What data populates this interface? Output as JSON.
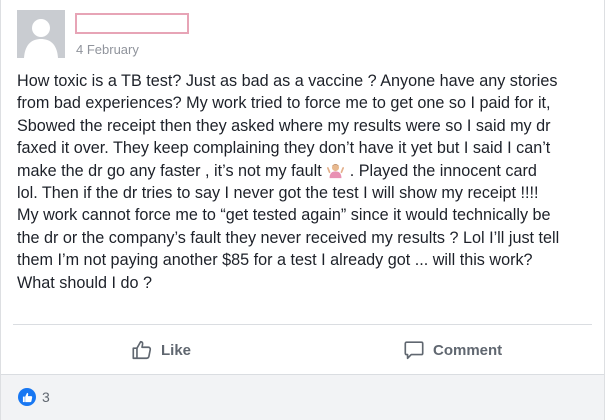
{
  "post": {
    "date": "4 February",
    "lines": [
      "How toxic is a TB test? Just as bad as a vaccine ? Anyone have any stories",
      "from bad experiences? My work tried to force me to get one so I paid for it,",
      "Sbowed the receipt then they asked where my results were so I said my dr",
      "faxed it over. They keep complaining they don’t have it yet but I said I can’t",
      "make the dr go any faster , it’s not my fault",
      ". Played the innocent card",
      "lol. Then if the dr tries to say I never got the test I will show my receipt !!!!",
      "My work cannot force me to “get tested again” since it would technically be",
      "the dr or the company’s fault they never received my results ? Lol I’ll just tell",
      "them I’m not paying another $85 for a test I already got ... will this work?",
      "What should I do ?"
    ],
    "emoji": "person-shrugging-emoji"
  },
  "actions": {
    "like_label": "Like",
    "comment_label": "Comment"
  },
  "reactions": {
    "count": "3",
    "icon": "thumbs-up-icon"
  },
  "colors": {
    "accent": "#1877f2",
    "redaction_border": "#e7a4b6",
    "muted_text": "#606770",
    "footer_bg": "#f2f3f5"
  }
}
